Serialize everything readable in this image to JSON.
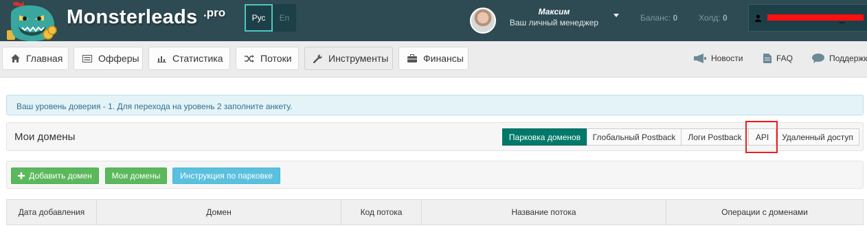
{
  "brand": {
    "name": "Monsterleads",
    "suffix": ".pro"
  },
  "languages": {
    "active": "Рус",
    "other": "En"
  },
  "manager": {
    "name": "Максим",
    "subtitle": "Ваш личный менеджер"
  },
  "stats": [
    {
      "label": "Баланс:",
      "value": "0"
    },
    {
      "label": "Холд:",
      "value": "0"
    }
  ],
  "user": {
    "name": "_"
  },
  "nav": {
    "items": [
      {
        "label": "Главная",
        "icon": "home-icon"
      },
      {
        "label": "Офферы",
        "icon": "list-icon"
      },
      {
        "label": "Статистика",
        "icon": "bar-chart-icon"
      },
      {
        "label": "Потоки",
        "icon": "shuffle-icon"
      },
      {
        "label": "Инструменты",
        "icon": "wrench-icon"
      },
      {
        "label": "Финансы",
        "icon": "briefcase-icon"
      }
    ],
    "right": [
      {
        "label": "Новости",
        "icon": "megaphone-icon"
      },
      {
        "label": "FAQ",
        "icon": "document-icon"
      },
      {
        "label": "Поддержк",
        "icon": "chat-icon"
      }
    ]
  },
  "alert": "Ваш уровень доверия - 1. Для перехода на уровень 2 заполните анкету.",
  "panel": {
    "title": "Мои домены",
    "tabs": [
      "Парковка доменов",
      "Глобальный Postback",
      "Логи Postback",
      "API",
      "Удаленный доступ"
    ],
    "active_tab": "Парковка доменов",
    "highlighted_tab": "API"
  },
  "actions": {
    "add_domain": "Добавить домен",
    "my_domains": "Мои домены",
    "parking_guide": "Инструкция по парковке"
  },
  "table": {
    "columns": [
      "Дата добавления",
      "Домен",
      "Код потока",
      "Название потока",
      "Операции с доменами"
    ]
  },
  "colors": {
    "header_bg": "#2e4a52",
    "accent_teal": "#00796b",
    "highlight_red": "#ee1c1c",
    "button_green": "#5cb85c",
    "button_blue": "#5bc0de"
  }
}
